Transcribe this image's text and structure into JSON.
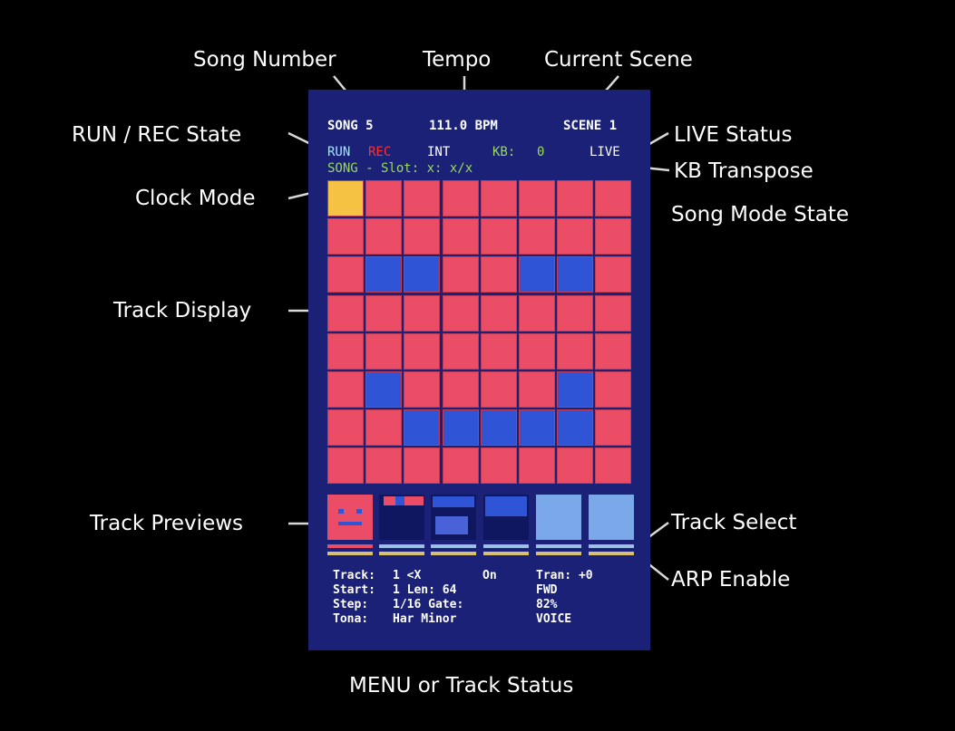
{
  "annotations": {
    "song_number": "Song Number",
    "tempo": "Tempo",
    "current_scene": "Current Scene",
    "run_rec_state": "RUN / REC State",
    "live_status": "LIVE Status",
    "kb_transpose": "KB Transpose",
    "clock_mode": "Clock Mode",
    "song_mode_state": "Song Mode State",
    "track_display": "Track Display",
    "track_previews": "Track Previews",
    "track_select": "Track Select",
    "arp_enable": "ARP Enable",
    "menu_or_track_status": "MENU or Track Status"
  },
  "screen": {
    "header": {
      "song": "SONG 5",
      "tempo": "111.0 BPM",
      "scene": "SCENE 1"
    },
    "status": {
      "run": "RUN",
      "rec": "REC",
      "clock": "INT",
      "kb_label": "KB:",
      "kb_value": "0",
      "live": "LIVE"
    },
    "song_line": "SONG - Slot: x: x/x",
    "grid": [
      "YRRRRRRR",
      "RRRRRRRR",
      "RBBRRBBR",
      "RRRRRRRR",
      "RRRRRRRR",
      "RBRRRRBR",
      "RRBBBBBR",
      "RRRRRRRR"
    ],
    "track_status": [
      {
        "a": "Track:",
        "b": "1 <X",
        "c": "On",
        "d": "Tran: +0"
      },
      {
        "a": "Start:",
        "b": "1  Len: 64",
        "c": "",
        "d": "FWD"
      },
      {
        "a": "Step:",
        "b": "1/16  Gate:",
        "c": "",
        "d": "82%"
      },
      {
        "a": "Tona:",
        "b": "Har Minor",
        "c": "",
        "d": "VOICE"
      }
    ]
  },
  "colors": {
    "screen_bg": "#1a2176",
    "cell_red": "#ec4d66",
    "cell_blue": "#2f55d6",
    "cell_yellow": "#f6c244",
    "header_text": "#ffffff",
    "run_text": "#a6e3ff",
    "rec_text": "#ff3030",
    "kb_text": "#9cd85e",
    "song_line_text": "#9cd85e",
    "preview_light": "#7aa8e8",
    "select_bar": "#9cc0e6",
    "arp_bar": "#d8c070"
  }
}
